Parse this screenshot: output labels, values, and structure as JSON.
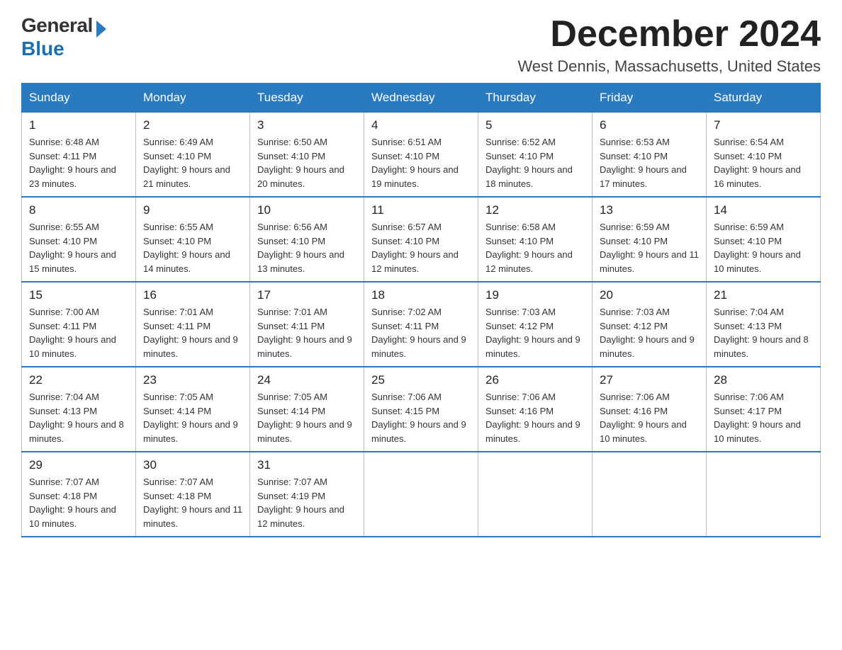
{
  "logo": {
    "general": "General",
    "blue": "Blue"
  },
  "header": {
    "month": "December 2024",
    "location": "West Dennis, Massachusetts, United States"
  },
  "days_of_week": [
    "Sunday",
    "Monday",
    "Tuesday",
    "Wednesday",
    "Thursday",
    "Friday",
    "Saturday"
  ],
  "weeks": [
    [
      {
        "day": "1",
        "sunrise": "6:48 AM",
        "sunset": "4:11 PM",
        "daylight": "9 hours and 23 minutes."
      },
      {
        "day": "2",
        "sunrise": "6:49 AM",
        "sunset": "4:10 PM",
        "daylight": "9 hours and 21 minutes."
      },
      {
        "day": "3",
        "sunrise": "6:50 AM",
        "sunset": "4:10 PM",
        "daylight": "9 hours and 20 minutes."
      },
      {
        "day": "4",
        "sunrise": "6:51 AM",
        "sunset": "4:10 PM",
        "daylight": "9 hours and 19 minutes."
      },
      {
        "day": "5",
        "sunrise": "6:52 AM",
        "sunset": "4:10 PM",
        "daylight": "9 hours and 18 minutes."
      },
      {
        "day": "6",
        "sunrise": "6:53 AM",
        "sunset": "4:10 PM",
        "daylight": "9 hours and 17 minutes."
      },
      {
        "day": "7",
        "sunrise": "6:54 AM",
        "sunset": "4:10 PM",
        "daylight": "9 hours and 16 minutes."
      }
    ],
    [
      {
        "day": "8",
        "sunrise": "6:55 AM",
        "sunset": "4:10 PM",
        "daylight": "9 hours and 15 minutes."
      },
      {
        "day": "9",
        "sunrise": "6:55 AM",
        "sunset": "4:10 PM",
        "daylight": "9 hours and 14 minutes."
      },
      {
        "day": "10",
        "sunrise": "6:56 AM",
        "sunset": "4:10 PM",
        "daylight": "9 hours and 13 minutes."
      },
      {
        "day": "11",
        "sunrise": "6:57 AM",
        "sunset": "4:10 PM",
        "daylight": "9 hours and 12 minutes."
      },
      {
        "day": "12",
        "sunrise": "6:58 AM",
        "sunset": "4:10 PM",
        "daylight": "9 hours and 12 minutes."
      },
      {
        "day": "13",
        "sunrise": "6:59 AM",
        "sunset": "4:10 PM",
        "daylight": "9 hours and 11 minutes."
      },
      {
        "day": "14",
        "sunrise": "6:59 AM",
        "sunset": "4:10 PM",
        "daylight": "9 hours and 10 minutes."
      }
    ],
    [
      {
        "day": "15",
        "sunrise": "7:00 AM",
        "sunset": "4:11 PM",
        "daylight": "9 hours and 10 minutes."
      },
      {
        "day": "16",
        "sunrise": "7:01 AM",
        "sunset": "4:11 PM",
        "daylight": "9 hours and 9 minutes."
      },
      {
        "day": "17",
        "sunrise": "7:01 AM",
        "sunset": "4:11 PM",
        "daylight": "9 hours and 9 minutes."
      },
      {
        "day": "18",
        "sunrise": "7:02 AM",
        "sunset": "4:11 PM",
        "daylight": "9 hours and 9 minutes."
      },
      {
        "day": "19",
        "sunrise": "7:03 AM",
        "sunset": "4:12 PM",
        "daylight": "9 hours and 9 minutes."
      },
      {
        "day": "20",
        "sunrise": "7:03 AM",
        "sunset": "4:12 PM",
        "daylight": "9 hours and 9 minutes."
      },
      {
        "day": "21",
        "sunrise": "7:04 AM",
        "sunset": "4:13 PM",
        "daylight": "9 hours and 8 minutes."
      }
    ],
    [
      {
        "day": "22",
        "sunrise": "7:04 AM",
        "sunset": "4:13 PM",
        "daylight": "9 hours and 8 minutes."
      },
      {
        "day": "23",
        "sunrise": "7:05 AM",
        "sunset": "4:14 PM",
        "daylight": "9 hours and 9 minutes."
      },
      {
        "day": "24",
        "sunrise": "7:05 AM",
        "sunset": "4:14 PM",
        "daylight": "9 hours and 9 minutes."
      },
      {
        "day": "25",
        "sunrise": "7:06 AM",
        "sunset": "4:15 PM",
        "daylight": "9 hours and 9 minutes."
      },
      {
        "day": "26",
        "sunrise": "7:06 AM",
        "sunset": "4:16 PM",
        "daylight": "9 hours and 9 minutes."
      },
      {
        "day": "27",
        "sunrise": "7:06 AM",
        "sunset": "4:16 PM",
        "daylight": "9 hours and 10 minutes."
      },
      {
        "day": "28",
        "sunrise": "7:06 AM",
        "sunset": "4:17 PM",
        "daylight": "9 hours and 10 minutes."
      }
    ],
    [
      {
        "day": "29",
        "sunrise": "7:07 AM",
        "sunset": "4:18 PM",
        "daylight": "9 hours and 10 minutes."
      },
      {
        "day": "30",
        "sunrise": "7:07 AM",
        "sunset": "4:18 PM",
        "daylight": "9 hours and 11 minutes."
      },
      {
        "day": "31",
        "sunrise": "7:07 AM",
        "sunset": "4:19 PM",
        "daylight": "9 hours and 12 minutes."
      },
      null,
      null,
      null,
      null
    ]
  ]
}
